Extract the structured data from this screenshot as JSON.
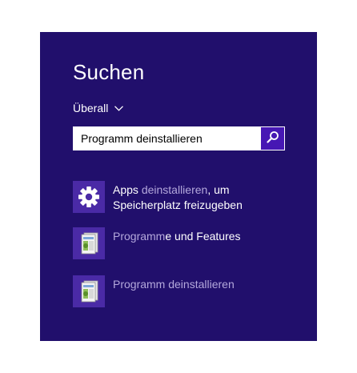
{
  "search": {
    "title": "Suchen",
    "scope_label": "Überall",
    "query": "Programm deinstallieren",
    "search_icon": "magnifier-icon"
  },
  "results": [
    {
      "icon": "gear-icon",
      "line1_part1": "Apps ",
      "line1_part2": "deinstallieren",
      "line1_part3": ", um",
      "line2": "Speicherplatz freizugeben"
    },
    {
      "icon": "control-panel-icon",
      "part1": "Programm",
      "part2": "e und Features"
    },
    {
      "icon": "control-panel-icon",
      "text": "Programm deinstallieren"
    }
  ],
  "colors": {
    "charm_background": "#210f6c",
    "search_button": "#4617b4",
    "tile_background": "#4a2aa6",
    "dim_text": "#b4a8dc",
    "highlight_text": "#ffffff"
  }
}
